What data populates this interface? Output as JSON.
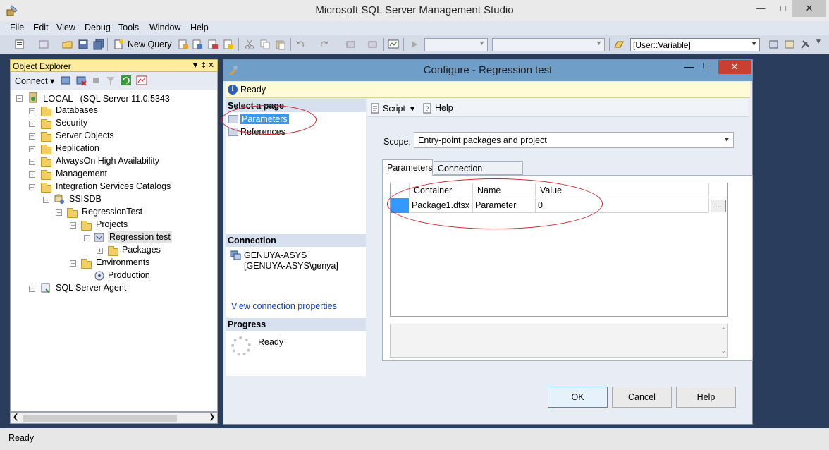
{
  "app": {
    "title": "Microsoft SQL Server Management Studio"
  },
  "menu": [
    "File",
    "Edit",
    "View",
    "Debug",
    "Tools",
    "Window",
    "Help"
  ],
  "toolbar": {
    "new_query": "New Query",
    "variable_combo": "[User::Variable]"
  },
  "object_explorer": {
    "title": "Object Explorer",
    "connect": "Connect",
    "server_name": "LOCAL",
    "server_detail": "(SQL Server 11.0.5343 -",
    "nodes": {
      "databases": "Databases",
      "security": "Security",
      "server_objects": "Server Objects",
      "replication": "Replication",
      "alwayson": "AlwaysOn High Availability",
      "management": "Management",
      "is_catalogs": "Integration Services Catalogs",
      "ssisdb": "SSISDB",
      "regressiontest": "RegressionTest",
      "projects": "Projects",
      "regression_test": "Regression test",
      "packages": "Packages",
      "environments": "Environments",
      "production": "Production",
      "sql_agent": "SQL Server Agent"
    }
  },
  "dialog": {
    "title": "Configure - Regression test",
    "status": "Ready",
    "select_page_header": "Select a page",
    "pages": [
      "Parameters",
      "References"
    ],
    "connection_header": "Connection",
    "connection_server": "GENUYA-ASYS",
    "connection_user": "[GENUYA-ASYS\\genya]",
    "view_connection_link": "View connection properties",
    "progress_header": "Progress",
    "progress_status": "Ready",
    "script_label": "Script",
    "help_label": "Help",
    "scope_label": "Scope:",
    "scope_value": "Entry-point packages and project",
    "tabs": [
      "Parameters",
      "Connection Managers"
    ],
    "grid_headers": {
      "container": "Container",
      "name": "Name",
      "value": "Value"
    },
    "grid_row": {
      "container": "Package1.dtsx",
      "name": "Parameter",
      "value": "0"
    },
    "ellipsis_label": "...",
    "buttons": {
      "ok": "OK",
      "cancel": "Cancel",
      "help": "Help"
    }
  },
  "statusbar": {
    "text": "Ready"
  }
}
